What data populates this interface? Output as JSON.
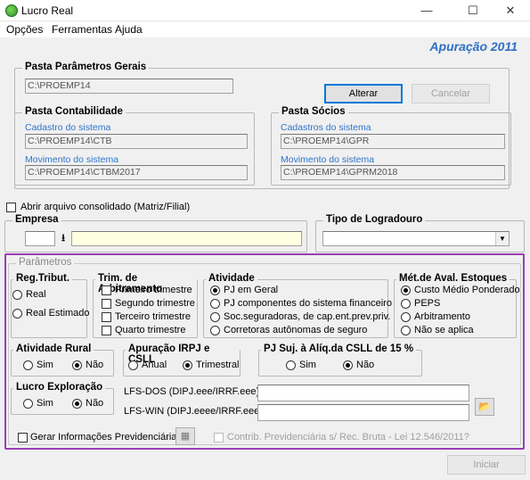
{
  "window": {
    "title": "Lucro Real",
    "minimize": "—",
    "maximize": "☐",
    "close": "✕"
  },
  "menu": [
    "Opções",
    "Ferramentas",
    "Ajuda"
  ],
  "header": {
    "apuracao": "Apuração 2011"
  },
  "pasta_parametros": {
    "legend": "Pasta Parâmetros Gerais",
    "path": "C:\\PROEMP14"
  },
  "buttons": {
    "alterar": "Alterar",
    "cancelar": "Cancelar",
    "iniciar": "Iniciar"
  },
  "pasta_contabilidade": {
    "legend": "Pasta Contabilidade",
    "cadastro_label": "Cadastro do sistema",
    "cadastro_path": "C:\\PROEMP14\\CTB",
    "movimento_label": "Movimento do sistema",
    "movimento_path": "C:\\PROEMP14\\CTBM2017"
  },
  "pasta_socios": {
    "legend": "Pasta Sócios",
    "cadastro_label": "Cadastros do sistema",
    "cadastro_path": "C:\\PROEMP14\\GPR",
    "movimento_label": "Movimento do sistema",
    "movimento_path": "C:\\PROEMP14\\GPRM2018"
  },
  "consolidado": {
    "label": "Abrir arquivo consolidado (Matriz/Filial)"
  },
  "empresa": {
    "legend": "Empresa",
    "code": "",
    "name": ""
  },
  "logradouro": {
    "legend": "Tipo de Logradouro",
    "value": ""
  },
  "parametros": {
    "legend": "Parâmetros",
    "reg_tribut": {
      "legend": "Reg.Tribut.",
      "options": [
        "Real",
        "Real Estimado"
      ]
    },
    "trim_arbitramento": {
      "legend": "Trim. de Arbitramento",
      "options": [
        "Primeiro trimestre",
        "Segundo trimestre",
        "Terceiro trimestre",
        "Quarto trimestre"
      ]
    },
    "atividade": {
      "legend": "Atividade",
      "selected": 0,
      "options": [
        "PJ em Geral",
        "PJ componentes do sistema financeiro",
        "Soc.seguradoras, de cap.ent.prev.priv.",
        "Corretoras autônomas de seguro"
      ]
    },
    "met_aval": {
      "legend": "Mét.de Aval. Estoques",
      "selected": 0,
      "options": [
        "Custo Médio Ponderado",
        "PEPS",
        "Arbitramento",
        "Não se aplica"
      ]
    },
    "atividade_rural": {
      "legend": "Atividade Rural",
      "sim": "Sim",
      "nao": "Não",
      "selected": "nao"
    },
    "apuracao_irpj": {
      "legend": "Apuração IRPJ e CSLL",
      "anual": "Anual",
      "trimestral": "Trimestral",
      "selected": "trimestral"
    },
    "pj_suj": {
      "legend": "PJ Suj. à Alíq.da CSLL de 15 %",
      "sim": "Sim",
      "nao": "Não",
      "selected": "nao"
    },
    "lucro_exploracao": {
      "legend": "Lucro Exploração",
      "sim": "Sim",
      "nao": "Não",
      "selected": "nao"
    },
    "lfs_dos": {
      "label": "LFS-DOS (DIPJ.eee/IRRF.eee)",
      "value": ""
    },
    "lfs_win": {
      "label": "LFS-WIN (DIPJ.eeee/IRRF.eeee)",
      "value": ""
    },
    "gerar_info": {
      "label": "Gerar Informações Previdenciárias"
    },
    "contrib": {
      "label": "Contrib. Previdenciária s/ Rec. Bruta - Lei 12.546/2011?"
    }
  }
}
